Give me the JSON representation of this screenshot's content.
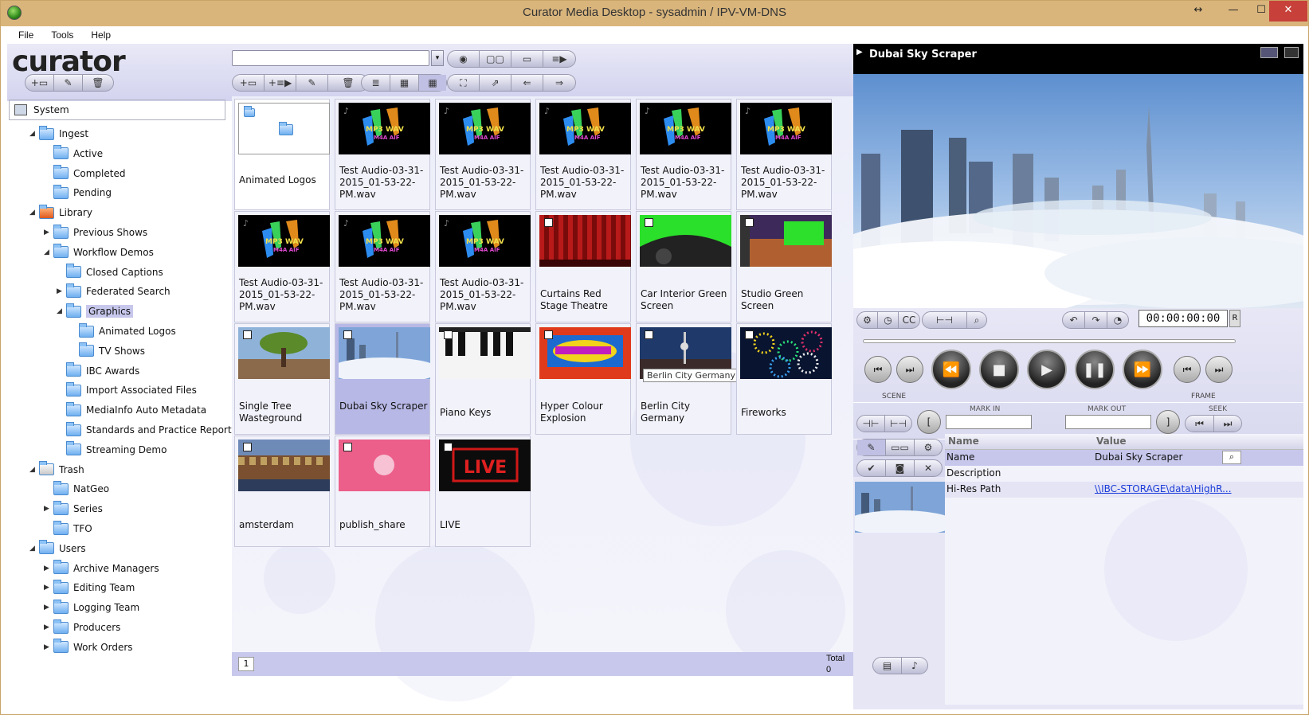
{
  "window": {
    "title": "Curator Media Desktop - sysadmin / IPV-VM-DNS"
  },
  "menu": [
    "File",
    "Tools",
    "Help"
  ],
  "brand": {
    "logo": "curator"
  },
  "tree": {
    "root": "System",
    "nodes": [
      {
        "label": "Ingest",
        "depth": 0,
        "open": true
      },
      {
        "label": "Active",
        "depth": 1
      },
      {
        "label": "Completed",
        "depth": 1
      },
      {
        "label": "Pending",
        "depth": 1
      },
      {
        "label": "Library",
        "depth": 0,
        "open": true
      },
      {
        "label": "Previous Shows",
        "depth": 1,
        "collapsed": true
      },
      {
        "label": "Workflow Demos",
        "depth": 1,
        "open": true
      },
      {
        "label": "Closed Captions",
        "depth": 2
      },
      {
        "label": "Federated Search",
        "depth": 2,
        "collapsed": true
      },
      {
        "label": "Graphics",
        "depth": 2,
        "open": true,
        "selected": true
      },
      {
        "label": "Animated Logos",
        "depth": 3
      },
      {
        "label": "TV Shows",
        "depth": 3
      },
      {
        "label": "IBC Awards",
        "depth": 2
      },
      {
        "label": "Import Associated Files",
        "depth": 2
      },
      {
        "label": "MediaInfo Auto Metadata",
        "depth": 2
      },
      {
        "label": "Standards and Practice Reports",
        "depth": 2
      },
      {
        "label": "Streaming Demo",
        "depth": 2
      },
      {
        "label": "Trash",
        "depth": 0,
        "open": true
      },
      {
        "label": "NatGeo",
        "depth": 1
      },
      {
        "label": "Series",
        "depth": 1,
        "collapsed": true
      },
      {
        "label": "TFO",
        "depth": 1
      },
      {
        "label": "Users",
        "depth": 0,
        "open": true
      },
      {
        "label": "Archive Managers",
        "depth": 1,
        "collapsed": true
      },
      {
        "label": "Editing Team",
        "depth": 1,
        "collapsed": true
      },
      {
        "label": "Logging Team",
        "depth": 1,
        "collapsed": true
      },
      {
        "label": "Producers",
        "depth": 1,
        "collapsed": true
      },
      {
        "label": "Work Orders",
        "depth": 1,
        "collapsed": true
      }
    ]
  },
  "search": {
    "value": ""
  },
  "grid": {
    "items": [
      {
        "label": "Animated Logos",
        "kind": "folder"
      },
      {
        "label": "Test Audio-03-31-2015_01-53-22-PM.wav",
        "kind": "audio"
      },
      {
        "label": "Test Audio-03-31-2015_01-53-22-PM.wav",
        "kind": "audio"
      },
      {
        "label": "Test Audio-03-31-2015_01-53-22-PM.wav",
        "kind": "audio"
      },
      {
        "label": "Test Audio-03-31-2015_01-53-22-PM.wav",
        "kind": "audio"
      },
      {
        "label": "Test Audio-03-31-2015_01-53-22-PM.wav",
        "kind": "audio"
      },
      {
        "label": "Test Audio-03-31-2015_01-53-22-PM.wav",
        "kind": "audio"
      },
      {
        "label": "Test Audio-03-31-2015_01-53-22-PM.wav",
        "kind": "audio"
      },
      {
        "label": "Test Audio-03-31-2015_01-53-22-PM.wav",
        "kind": "audio"
      },
      {
        "label": "Curtains Red Stage Theatre",
        "kind": "curtain"
      },
      {
        "label": "Car Interior Green Screen",
        "kind": "car"
      },
      {
        "label": "Studio Green Screen",
        "kind": "studio"
      },
      {
        "label": "Single Tree Wasteground",
        "kind": "tree"
      },
      {
        "label": "Dubai Sky Scraper",
        "kind": "dubai",
        "selected": true
      },
      {
        "label": "Piano Keys",
        "kind": "piano"
      },
      {
        "label": "Hyper Colour Explosion",
        "kind": "hyper"
      },
      {
        "label": "Berlin City Germany",
        "kind": "berlin",
        "tooltip": "Berlin City Germany"
      },
      {
        "label": "Fireworks",
        "kind": "fireworks"
      },
      {
        "label": "amsterdam",
        "kind": "amsterdam"
      },
      {
        "label": "publish_share",
        "kind": "publish"
      },
      {
        "label": "LIVE",
        "kind": "live"
      }
    ],
    "page": "1",
    "total_label": "Total",
    "total_value": "0"
  },
  "audio_badge": {
    "line1": "MP3 WAV",
    "line2": "M4A AIF"
  },
  "live_text": "LIVE",
  "player": {
    "title": "Dubai Sky Scraper",
    "timecode": "00:00:00:00",
    "labels": {
      "scene": "SCENE",
      "frame": "FRAME",
      "mark_in": "MARK IN",
      "mark_out": "MARK OUT",
      "seek": "SEEK",
      "cc": "CC"
    },
    "mark_in": "",
    "mark_out": ""
  },
  "properties": {
    "headers": [
      "Name",
      "Value"
    ],
    "rows": [
      {
        "name": "Name",
        "value": "Dubai Sky Scraper"
      },
      {
        "name": "Description",
        "value": ""
      },
      {
        "name": "Hi-Res Path",
        "value": "\\\\IBC-STORAGE\\data\\HighR..."
      }
    ]
  }
}
